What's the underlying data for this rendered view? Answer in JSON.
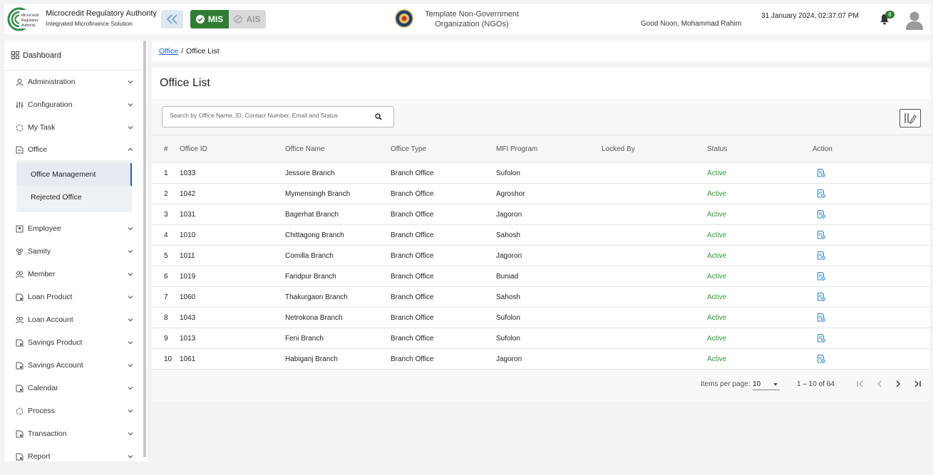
{
  "header": {
    "brand_title": "Microcredit Regulatory Authority",
    "brand_subtitle": "Integrated Microfinance Solution",
    "logo_text": "Microcredit Regulatory Authority",
    "mis_label": "MIS",
    "ais_label": "AIS",
    "org_name": "Template Non-Government Organization (NGOs)",
    "greeting": "Good Noon, Mohammad Rahim",
    "datetime": "31 January 2024, 02:37:07 PM",
    "notification_count": "8"
  },
  "sidebar": {
    "dashboard": "Dashboard",
    "items": [
      {
        "label": "Administration",
        "icon": "admin-icon"
      },
      {
        "label": "Configuration",
        "icon": "config-icon"
      },
      {
        "label": "My Task",
        "icon": "task-icon"
      },
      {
        "label": "Office",
        "icon": "office-icon"
      },
      {
        "label": "Employee",
        "icon": "employee-icon"
      },
      {
        "label": "Samity",
        "icon": "samity-icon"
      },
      {
        "label": "Member",
        "icon": "member-icon"
      },
      {
        "label": "Loan Product",
        "icon": "loan-product-icon"
      },
      {
        "label": "Loan Account",
        "icon": "loan-account-icon"
      },
      {
        "label": "Savings Product",
        "icon": "savings-product-icon"
      },
      {
        "label": "Savings Account",
        "icon": "savings-account-icon"
      },
      {
        "label": "Calendar",
        "icon": "calendar-icon"
      },
      {
        "label": "Process",
        "icon": "process-icon"
      },
      {
        "label": "Transaction",
        "icon": "transaction-icon"
      },
      {
        "label": "Report",
        "icon": "report-icon"
      }
    ],
    "office_sub": [
      "Office Management",
      "Rejected Office"
    ]
  },
  "breadcrumb": {
    "link": "Office",
    "separator": "/",
    "current": "Office List"
  },
  "page": {
    "title": "Office List",
    "search_placeholder": "Search by Office Name, ID, Contact Number, Email and Status"
  },
  "table": {
    "headers": [
      "#",
      "Office ID",
      "Office Name",
      "Office Type",
      "MFI Program",
      "Locked By",
      "Status",
      "Action"
    ],
    "rows": [
      {
        "num": "1",
        "id": "1033",
        "name": "Jessore Branch",
        "type": "Branch Office",
        "mfi": "Sufolon",
        "locked": "",
        "status": "Active"
      },
      {
        "num": "2",
        "id": "1042",
        "name": "Mymensingh Branch",
        "type": "Branch Office",
        "mfi": "Agroshor",
        "locked": "",
        "status": "Active"
      },
      {
        "num": "3",
        "id": "1031",
        "name": "Bagerhat Branch",
        "type": "Branch Office",
        "mfi": "Jagoron",
        "locked": "",
        "status": "Active"
      },
      {
        "num": "4",
        "id": "1010",
        "name": "Chittagong Branch",
        "type": "Branch Office",
        "mfi": "Sahosh",
        "locked": "",
        "status": "Active"
      },
      {
        "num": "5",
        "id": "1011",
        "name": "Comilla Branch",
        "type": "Branch Office",
        "mfi": "Jagoron",
        "locked": "",
        "status": "Active"
      },
      {
        "num": "6",
        "id": "1019",
        "name": "Faridpur Branch",
        "type": "Branch Office",
        "mfi": "Buniad",
        "locked": "",
        "status": "Active"
      },
      {
        "num": "7",
        "id": "1060",
        "name": "Thakurgaon Branch",
        "type": "Branch Office",
        "mfi": "Sahosh",
        "locked": "",
        "status": "Active"
      },
      {
        "num": "8",
        "id": "1043",
        "name": "Netrokona Branch",
        "type": "Branch Office",
        "mfi": "Sufolon",
        "locked": "",
        "status": "Active"
      },
      {
        "num": "9",
        "id": "1013",
        "name": "Feni Branch",
        "type": "Branch Office",
        "mfi": "Sufolon",
        "locked": "",
        "status": "Active"
      },
      {
        "num": "10",
        "id": "1061",
        "name": "Habiganj Branch",
        "type": "Branch Office",
        "mfi": "Jagoron",
        "locked": "",
        "status": "Active"
      }
    ]
  },
  "paginator": {
    "items_per_page_label": "Items per page:",
    "items_per_page": "10",
    "range": "1 – 10 of 64"
  },
  "colors": {
    "accent_green": "#2e7d32",
    "status_active": "#2e9b34",
    "link_blue": "#1e63c4",
    "action_icon": "#2a7fd4"
  }
}
